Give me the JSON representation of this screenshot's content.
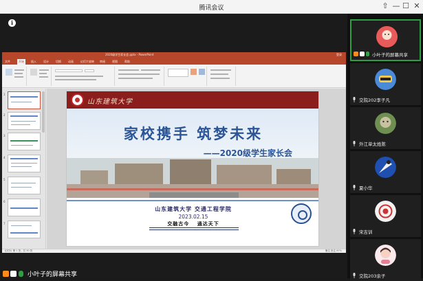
{
  "window": {
    "title": "腾讯会议",
    "controls": {
      "pin": "⇧",
      "minimize": "—",
      "maximize": "☐",
      "close": "✕"
    }
  },
  "stage": {
    "info_icon": "info-icon",
    "ppt": {
      "doc_title": "2020级学生家长会.pptx - PowerPoint",
      "user": "登录",
      "tabs": [
        "文件",
        "开始",
        "插入",
        "设计",
        "切换",
        "动画",
        "幻灯片放映",
        "审阅",
        "视图",
        "帮助"
      ],
      "active_tab": 1,
      "status_left": "幻灯片 第 1 张，共 30 张",
      "status_right": "备注  批注  87%"
    },
    "slide": {
      "logo_text": "山东建筑大学",
      "slogan": "家校携手    筑梦未来",
      "subtitle": "——2020级学生家长会",
      "college": "山东建筑大学 交通工程学院",
      "date": "2023.02.15",
      "motto": "交融古今   通达天下"
    }
  },
  "share_bar": {
    "label": "小叶子的屏幕共享"
  },
  "gallery": [
    {
      "name": "小叶子的屏幕共享",
      "avatar_color": "#e33b3b",
      "active": true
    },
    {
      "name": "交院202李子凡",
      "avatar_color": "#3b7fcf",
      "active": false
    },
    {
      "name": "外江单太姓陈",
      "avatar_color": "#7da35f",
      "active": false
    },
    {
      "name": "夏小华",
      "avatar_color": "#2a4fa0",
      "active": false
    },
    {
      "name": "宋吉训",
      "avatar_color": "#d9d9d9",
      "active": false
    },
    {
      "name": "交院203余子",
      "avatar_color": "#f3c2c7",
      "active": false
    }
  ],
  "colors": {
    "accent_green": "#2ea043",
    "ppt_red": "#b7472a",
    "slide_blue": "#2b5597"
  }
}
